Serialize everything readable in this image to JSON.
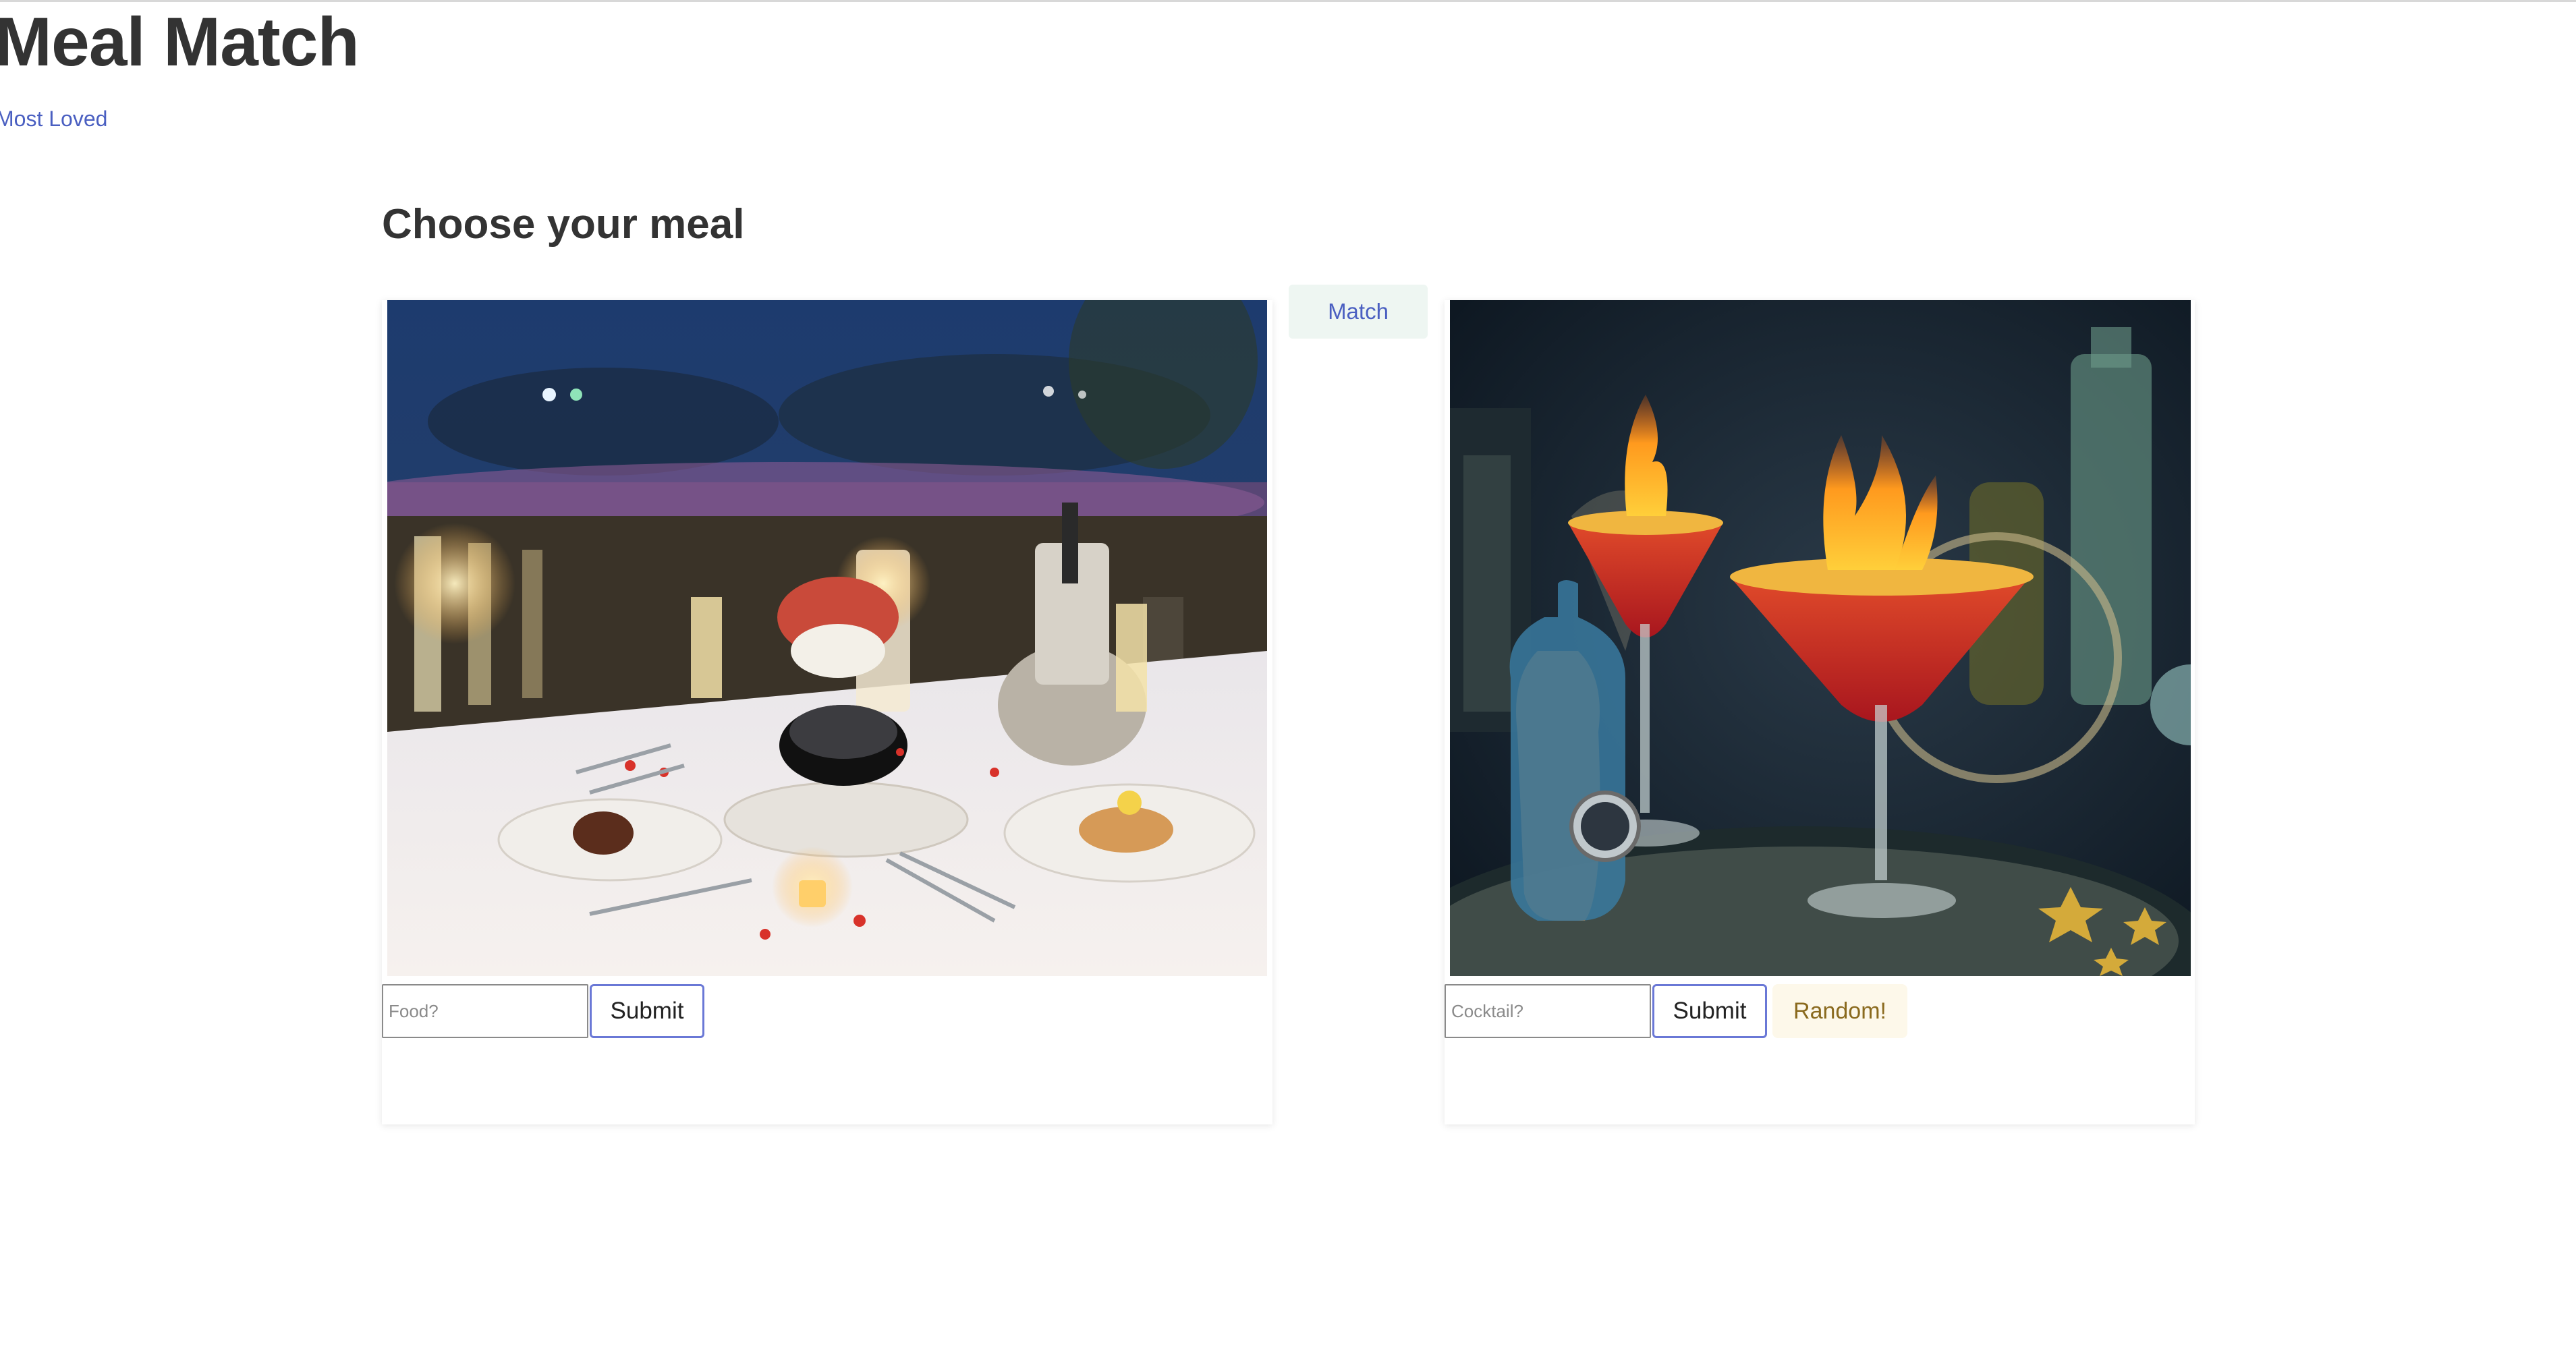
{
  "app": {
    "title": "Meal Match",
    "nav_link": "Most Loved"
  },
  "main": {
    "heading": "Choose your meal",
    "match_label": "Match"
  },
  "food_card": {
    "image_icon": "dinner-table-photo",
    "input_placeholder": "Food?",
    "input_value": "",
    "submit_label": "Submit"
  },
  "drink_card": {
    "image_icon": "flaming-cocktails-photo",
    "input_placeholder": "Cocktail?",
    "input_value": "",
    "submit_label": "Submit",
    "random_label": "Random!"
  },
  "colors": {
    "link": "#4a5fc1",
    "submit_border": "#6a78d6",
    "match_bg": "#eef6f2",
    "random_bg": "#fdf8ea",
    "random_text": "#8a6a1e"
  }
}
